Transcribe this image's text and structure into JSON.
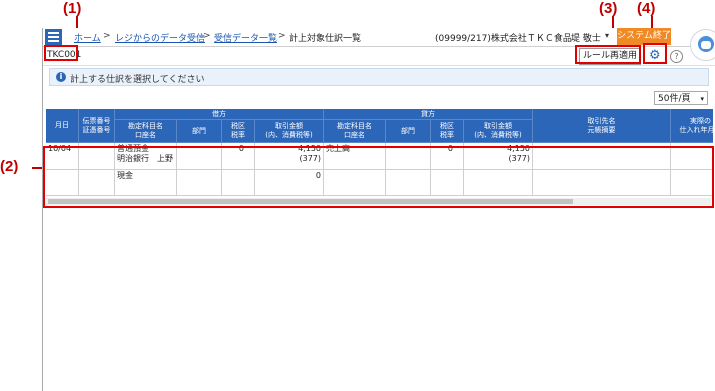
{
  "callouts": {
    "c1": "(1)",
    "c2": "(2)",
    "c3": "(3)",
    "c4": "(4)"
  },
  "nav": {
    "breadcrumb": {
      "home": "ホーム",
      "received_data": "レジからのデータ受信",
      "received_list": "受信データ一覧",
      "current": "計上対象仕訳一覧",
      "sep": ">"
    },
    "company": "(09999/217)株式会社ＴＫＣ食品",
    "user": "堤 敬士",
    "user_caret": "▾",
    "end_button": "システム終了"
  },
  "toolbar": {
    "company_code": "TKC001",
    "rule_button": "ルール再適用",
    "gear_glyph": "⚙",
    "help_glyph": "?"
  },
  "info": {
    "icon": "i",
    "message": "計上する仕訳を選択してください"
  },
  "paging": {
    "per_page": "50件/頁",
    "caret": "▾"
  },
  "table": {
    "headers": {
      "date": "月日",
      "slip": [
        "伝票番号",
        "証憑番号"
      ],
      "debit": "借方",
      "credit": "貸方",
      "account": [
        "勘定科目名",
        "口座名"
      ],
      "dept": "部門",
      "tax": [
        "税区",
        "税率"
      ],
      "amount": [
        "取引金額",
        "(内、消費税等)"
      ],
      "partner": [
        "取引先名",
        "元帳摘要"
      ],
      "actual": [
        "実際の",
        "仕入れ年月日"
      ]
    },
    "rows": [
      {
        "date": "10/04",
        "debit_account": "普通預金",
        "debit_sub": "明治銀行　上野",
        "debit_tax": "0",
        "debit_amount": "4,150",
        "debit_tax_amount": "(377)",
        "credit_account": "売上高",
        "credit_tax": "0",
        "credit_amount": "4,150",
        "credit_tax_amount": "(377)"
      },
      {
        "debit_account": "現金",
        "debit_amount": "0"
      }
    ]
  },
  "colors": {
    "header_blue": "#2c66b8",
    "callout_red": "#c00000",
    "end_orange": "#f08a24"
  }
}
